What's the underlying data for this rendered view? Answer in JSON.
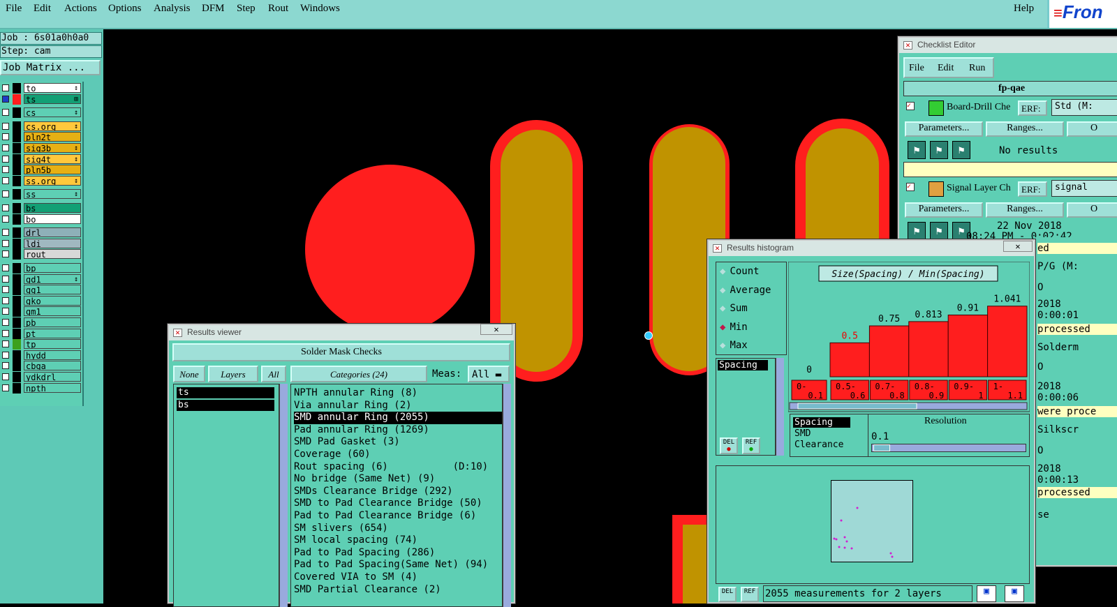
{
  "menubar": {
    "items": [
      "File",
      "Edit",
      "Actions",
      "Options",
      "Analysis",
      "DFM",
      "Step",
      "Rout",
      "Windows"
    ],
    "help": "Help",
    "logo": "Fron"
  },
  "job": {
    "label": "Job : 6s01a0h0a0",
    "step": "Step: cam",
    "matrix_button": "Job Matrix ..."
  },
  "layers": [
    {
      "name": "to",
      "color": "#ffffff",
      "swatch": "#000000",
      "mark": "↕"
    },
    {
      "name": "ts",
      "color": "#12a075",
      "swatch": "#ff1e1e",
      "mark": "⊞",
      "active": true
    },
    {
      "name": "cs",
      "color": "#5ecfb4",
      "swatch": "#000000",
      "mark": "↕"
    },
    {
      "name": "cs.org",
      "color": "#ffc83c",
      "swatch": "#000000",
      "mark": "↕"
    },
    {
      "name": "pln2t",
      "color": "#e6b014",
      "swatch": "#000000",
      "mark": ""
    },
    {
      "name": "sig3b",
      "color": "#e6b014",
      "swatch": "#000000",
      "mark": "↕"
    },
    {
      "name": "sig4t",
      "color": "#ffc83c",
      "swatch": "#000000",
      "mark": "↕"
    },
    {
      "name": "pln5b",
      "color": "#e6b014",
      "swatch": "#000000",
      "mark": ""
    },
    {
      "name": "ss.org",
      "color": "#ffc83c",
      "swatch": "#000000",
      "mark": "↕"
    },
    {
      "name": "ss",
      "color": "#5ecfb4",
      "swatch": "#000000",
      "mark": "↕"
    },
    {
      "name": "bs",
      "color": "#12a075",
      "swatch": "#000000",
      "mark": ""
    },
    {
      "name": "bo",
      "color": "#ffffff",
      "swatch": "#000000",
      "mark": ""
    },
    {
      "name": "drl",
      "color": "#8eb0b8",
      "swatch": "#000000",
      "mark": ""
    },
    {
      "name": "ldi",
      "color": "#a0b8c0",
      "swatch": "#000000",
      "mark": ""
    },
    {
      "name": "rout",
      "color": "#d8d8d8",
      "swatch": "#000000",
      "mark": ""
    },
    {
      "name": "bp",
      "color": "#5ecfb4",
      "swatch": "#000000",
      "mark": ""
    },
    {
      "name": "gd1",
      "color": "#5ecfb4",
      "swatch": "#000000",
      "mark": "↕"
    },
    {
      "name": "gg1",
      "color": "#5ecfb4",
      "swatch": "#000000",
      "mark": ""
    },
    {
      "name": "gko",
      "color": "#5ecfb4",
      "swatch": "#000000",
      "mark": ""
    },
    {
      "name": "gm1",
      "color": "#5ecfb4",
      "swatch": "#000000",
      "mark": ""
    },
    {
      "name": "pb",
      "color": "#5ecfb4",
      "swatch": "#000000",
      "mark": ""
    },
    {
      "name": "pt",
      "color": "#5ecfb4",
      "swatch": "#000000",
      "mark": ""
    },
    {
      "name": "tp",
      "color": "#5ecfb4",
      "swatch": "#3ca01e",
      "mark": ""
    },
    {
      "name": "hydd",
      "color": "#5ecfb4",
      "swatch": "#000000",
      "mark": ""
    },
    {
      "name": "cbga",
      "color": "#5ecfb4",
      "swatch": "#000000",
      "mark": ""
    },
    {
      "name": "ydkdrl",
      "color": "#5ecfb4",
      "swatch": "#000000",
      "mark": ""
    },
    {
      "name": "npth",
      "color": "#5ecfb4",
      "swatch": "#000000",
      "mark": ""
    }
  ],
  "checklist": {
    "title": "Checklist Editor",
    "menu": [
      "File",
      "Edit",
      "Run"
    ],
    "name": "fp-qae",
    "checks": [
      {
        "name": "Board-Drill Che",
        "erf": "ERF:",
        "erf_value": "Std (M:",
        "params": "Parameters...",
        "ranges": "Ranges...",
        "cut": "O",
        "status": "No results"
      },
      {
        "name": "Signal Layer Ch",
        "erf": "ERF:",
        "erf_value": "signal",
        "params": "Parameters...",
        "ranges": "Ranges...",
        "cut": "O",
        "date": "22 Nov 2018",
        "time": "08:24 PM - 0:02:42"
      }
    ],
    "right_fragments": [
      "ed",
      "P/G (M:",
      "O",
      "2018",
      "0:00:01",
      "processed",
      "Solderm",
      "O",
      "2018",
      "0:00:06",
      "were proce",
      "Silkscr",
      "O",
      "2018",
      "0:00:13",
      "processed",
      "se"
    ]
  },
  "results_viewer": {
    "title": "Results viewer",
    "header": "Solder Mask Checks",
    "none_btn": "None",
    "layers_btn": "Layers",
    "all_btn": "All",
    "categories_label": "Categories (24)",
    "meas_label": "Meas:",
    "meas_value": "All",
    "layers": [
      "ts",
      "bs"
    ],
    "categories": [
      "NPTH annular Ring (8)",
      "Via annular Ring (2)",
      "SMD annular Ring (2055)",
      "Pad annular Ring (1269)",
      "SMD Pad Gasket (3)",
      "Coverage (60)",
      "Rout spacing (6)           (D:10)",
      "No bridge (Same Net) (9)",
      "SMDs Clearance Bridge (292)",
      "SMD to Pad Clearance Bridge (50)",
      "Pad to Pad Clearance Bridge (6)",
      "SM slivers (654)",
      "SM local spacing (74)",
      "Pad to Pad Spacing (286)",
      "Pad to Pad Spacing(Same Net) (94)",
      "Covered VIA to SM (4)",
      "SMD Partial Clearance (2)"
    ],
    "selected_index": 2
  },
  "histogram": {
    "title": "Results histogram",
    "modes": [
      "Count",
      "Average",
      "Sum",
      "Min",
      "Max"
    ],
    "selected_mode": "Min",
    "list_item": "Spacing",
    "del_label": "DEL",
    "ref_label": "REF",
    "measurements": [
      "Spacing",
      "SMD",
      "Clearance"
    ],
    "resolution_label": "Resolution",
    "resolution_value": "0.1",
    "footer": "2055 measurements for 2 layers",
    "colors": {
      "bar": "#ff1e1e",
      "scatter": "#d020d0"
    }
  },
  "chart_data": {
    "type": "bar",
    "title": "Size(Spacing) / Min(Spacing)",
    "categories": [
      "0-0.1",
      "0.5-0.6",
      "0.7-0.8",
      "0.8-0.9",
      "0.9-1",
      "1-1.1"
    ],
    "values": [
      0,
      0.5,
      0.75,
      0.813,
      0.91,
      1.041
    ],
    "value_labels": [
      "0",
      "0.5",
      "0.75",
      "0.813",
      "0.91",
      "1.041"
    ],
    "ylim": [
      0,
      1.1
    ]
  }
}
